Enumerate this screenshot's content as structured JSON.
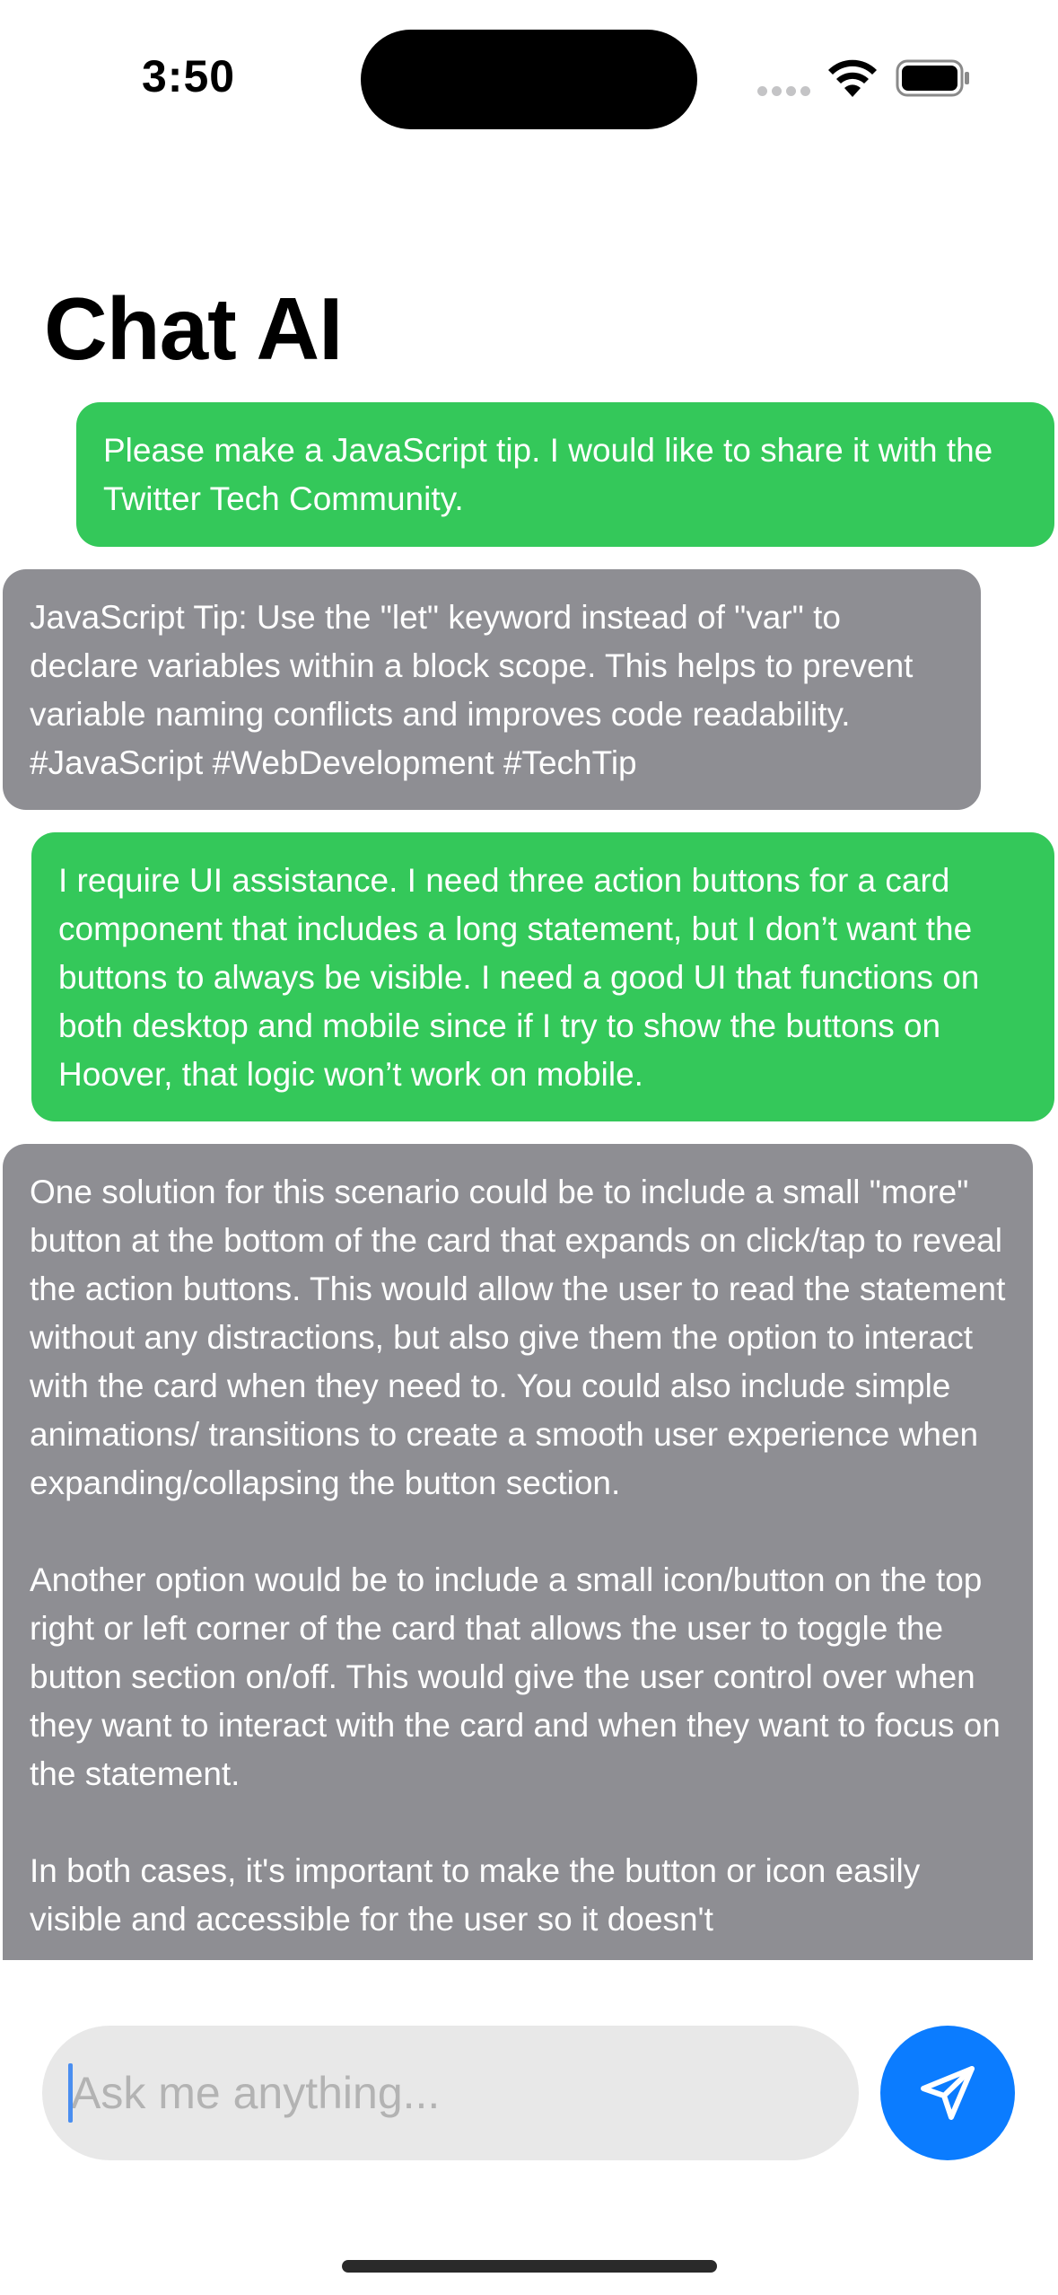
{
  "status_bar": {
    "time": "3:50"
  },
  "header": {
    "title": "Chat AI"
  },
  "messages": [
    {
      "role": "user",
      "text": "Please make a JavaScript tip. I would like to share it with the Twitter Tech Community."
    },
    {
      "role": "assistant",
      "text": "JavaScript Tip: Use the \"let\" keyword instead of \"var\" to declare variables within a block scope. This helps to prevent variable naming conflicts and improves code readability. #JavaScript #WebDevelopment #TechTip"
    },
    {
      "role": "user",
      "text": "I require UI assistance. I need three action buttons for a card component that includes a long statement, but I don’t want the buttons to always be visible. I need a good UI that functions on both desktop and mobile since if I try to show the buttons on Hoover, that logic won’t work on mobile."
    },
    {
      "role": "assistant",
      "text": "One solution for this scenario could be to include a small \"more\" button at the bottom of the card that expands on click/tap to reveal the action buttons. This would allow the user to read the statement without any distractions, but also give them the option to interact with the card when they need to. You could also include simple animations/ transitions to create a smooth user experience when expanding/collapsing the button section.\n\nAnother option would be to include a small icon/button on the top right or left corner of the card that allows the user to toggle the button section on/off. This would give the user control over when they want to interact with the card and when they want to focus on the statement.\n\nIn both cases, it's important to make the button or icon easily visible and accessible for the user so it doesn't"
    }
  ],
  "composer": {
    "placeholder": "Ask me anything...",
    "value": "",
    "send_icon": "paper-plane-icon"
  },
  "colors": {
    "user_bubble": "#34c85a",
    "assistant_bubble": "#8e8e93",
    "send_button": "#0b7cff",
    "input_background": "#e8e8e8"
  }
}
